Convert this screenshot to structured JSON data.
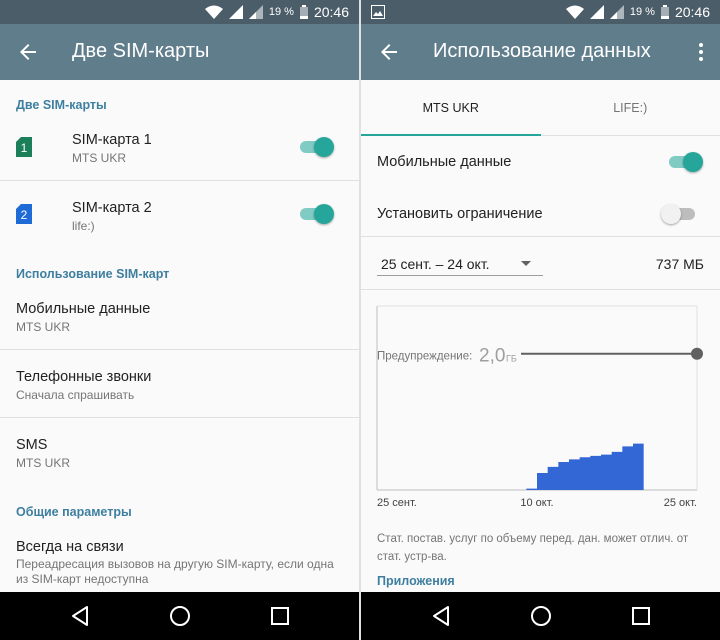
{
  "status": {
    "battery": "19 %",
    "time": "20:46"
  },
  "left": {
    "toolbar": {
      "title": "Две SIM-карты"
    },
    "sections": {
      "dual_sim": "Две SIM-карты",
      "sim_usage": "Использование SIM-карт",
      "general": "Общие параметры"
    },
    "sims": [
      {
        "badge": "1",
        "title": "SIM-карта 1",
        "operator": "MTS UKR",
        "enabled": true,
        "color": "#1b7f5a"
      },
      {
        "badge": "2",
        "title": "SIM-карта 2",
        "operator": "life:)",
        "enabled": true,
        "color": "#1e6bd8"
      }
    ],
    "mobile_data": {
      "title": "Мобильные данные",
      "value": "MTS UKR"
    },
    "calls": {
      "title": "Телефонные звонки",
      "value": "Сначала спрашивать"
    },
    "sms": {
      "title": "SMS",
      "value": "MTS UKR"
    },
    "always_on": {
      "title": "Всегда на связи",
      "line1": "Переадресация вызовов на другую SIM-карту, если одна",
      "line2": "из SIM-карт недоступна"
    }
  },
  "right": {
    "toolbar": {
      "title": "Использование данных"
    },
    "tabs": [
      {
        "label": "MTS UKR",
        "active": true
      },
      {
        "label": "LIFE:)",
        "active": false
      }
    ],
    "mobile_data": {
      "label": "Мобильные данные",
      "enabled": true
    },
    "set_limit": {
      "label": "Установить ограничение",
      "enabled": false
    },
    "cycle": {
      "label": "25 сент. – 24 окт.",
      "total": "737 МБ"
    },
    "note": "Стат. постав. услуг по объему перед. дан. может отлич. от стат. устр-ва.",
    "apps_header": "Приложения"
  },
  "chart_data": {
    "type": "area",
    "warning": {
      "label": "Предупреждение:",
      "value": "2,0",
      "unit": "ГБ",
      "gb": 2.0
    },
    "x_ticks": [
      "25 сент.",
      "10 окт.",
      "25 окт."
    ],
    "x_days": [
      0,
      1,
      2,
      3,
      4,
      5,
      6,
      7,
      8,
      9,
      10,
      11,
      12,
      13,
      14,
      15,
      16,
      17,
      18,
      19,
      20,
      21,
      22,
      23,
      24,
      25,
      26,
      27,
      28,
      29,
      30
    ],
    "ylim": [
      0,
      2.7
    ],
    "cumulative_gb": [
      null,
      null,
      null,
      null,
      null,
      null,
      null,
      null,
      null,
      null,
      null,
      null,
      null,
      null,
      0.02,
      0.25,
      0.34,
      0.41,
      0.45,
      0.48,
      0.5,
      0.52,
      0.56,
      0.64,
      0.68,
      0.72
    ],
    "color": "#3367d6"
  },
  "colors": {
    "accent": "#26a69a",
    "toolbar": "#607d8b",
    "statusbar": "#4b5d69",
    "section": "#3e7fa0"
  }
}
